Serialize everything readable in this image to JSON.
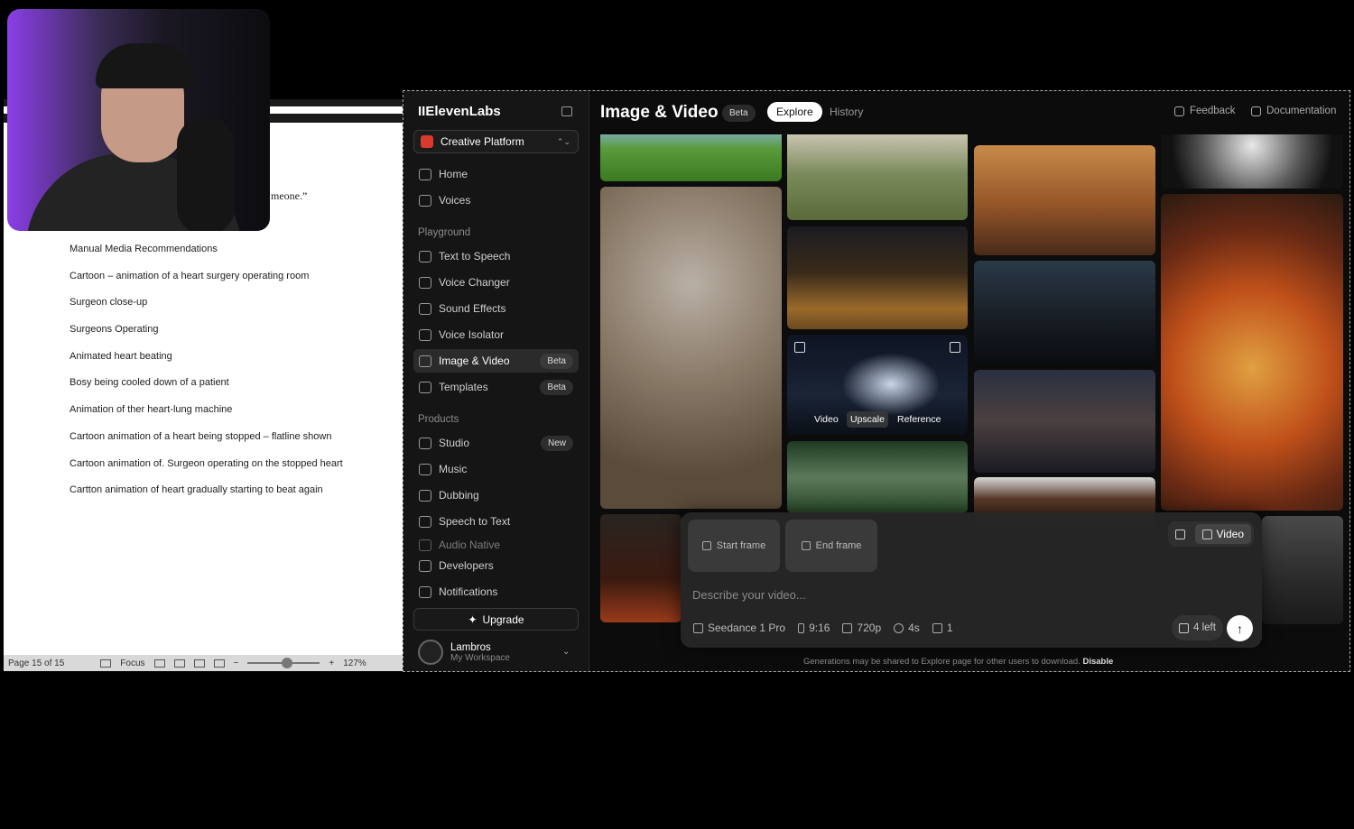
{
  "doc": {
    "quote_fragment": "meone.”",
    "items": [
      "Manual Media Recommendations",
      "Cartoon – animation of a heart surgery operating room",
      "Surgeon close-up",
      "Surgeons Operating",
      "Animated heart beating",
      "Bosy being cooled down of a patient",
      "Animation of ther heart-lung machine",
      "Cartoon animation of a heart being stopped – flatline shown",
      "Cartoon animation of. Surgeon operating on the stopped heart",
      "Cartton animation of heart gradually starting to beat again"
    ],
    "status": {
      "page": "Page 15 of 15",
      "focus": "Focus",
      "zoom": "127%"
    }
  },
  "sidebar": {
    "logo": "IIElevenLabs",
    "platform": "Creative Platform",
    "top_items": [
      {
        "label": "Home",
        "icon": "home-icon"
      },
      {
        "label": "Voices",
        "icon": "voices-icon"
      }
    ],
    "playground_label": "Playground",
    "playground": [
      {
        "label": "Text to Speech",
        "icon": "text-to-speech-icon"
      },
      {
        "label": "Voice Changer",
        "icon": "voice-changer-icon"
      },
      {
        "label": "Sound Effects",
        "icon": "sound-effects-icon"
      },
      {
        "label": "Voice Isolator",
        "icon": "voice-isolator-icon"
      },
      {
        "label": "Image & Video",
        "icon": "image-video-icon",
        "tag": "Beta",
        "active": true
      },
      {
        "label": "Templates",
        "icon": "templates-icon",
        "tag": "Beta"
      }
    ],
    "products_label": "Products",
    "products": [
      {
        "label": "Studio",
        "icon": "studio-icon",
        "tag": "New"
      },
      {
        "label": "Music",
        "icon": "music-icon"
      },
      {
        "label": "Dubbing",
        "icon": "dubbing-icon"
      },
      {
        "label": "Speech to Text",
        "icon": "speech-to-text-icon"
      },
      {
        "label": "Audio Native",
        "icon": "audio-native-icon"
      },
      {
        "label": "Developers",
        "icon": "developers-icon"
      },
      {
        "label": "Notifications",
        "icon": "bell-icon"
      }
    ],
    "upgrade": "Upgrade",
    "user": {
      "name": "Lambros",
      "workspace": "My Workspace"
    }
  },
  "main": {
    "title": "Image & Video",
    "beta": "Beta",
    "tabs": [
      "Explore",
      "History"
    ],
    "feedback": "Feedback",
    "documentation": "Documentation",
    "hover_actions": [
      "Video",
      "Upscale",
      "Reference"
    ],
    "composer": {
      "start_frame": "Start frame",
      "end_frame": "End frame",
      "mode": "Video",
      "placeholder": "Describe your video...",
      "model": "Seedance 1 Pro",
      "ratio": "9:16",
      "resolution": "720p",
      "duration": "4s",
      "count": "1",
      "credits": "4 left"
    },
    "footnote": "Generations may be shared to Explore page for other users to download.",
    "footnote_link": "Disable"
  },
  "colors": {
    "accent": "#d83a2d",
    "sidebar_bg": "#151515",
    "active": "#2b2b2b"
  }
}
